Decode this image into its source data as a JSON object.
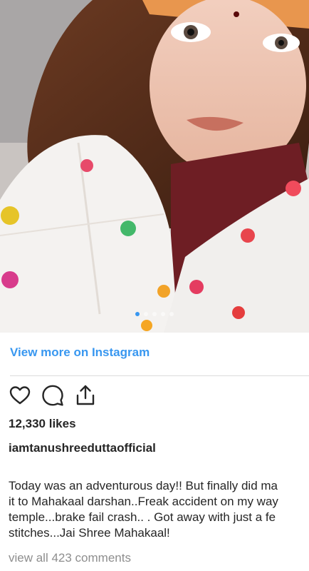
{
  "post": {
    "image_alt": "selfie photo",
    "carousel_dots": 5,
    "carousel_active_index": 0
  },
  "link": {
    "view_more": "View more on Instagram"
  },
  "actions": {
    "like_icon": "heart-icon",
    "comment_icon": "comment-icon",
    "share_icon": "share-icon"
  },
  "stats": {
    "likes": "12,330 likes"
  },
  "author": {
    "username": "iamtanushreeduttaofficial"
  },
  "caption": {
    "lines": [
      "Today was an adventurous day!! But finally did ma",
      "it to Mahakaal darshan..Freak accident on my way",
      "temple...brake fail crash.. . Got away with just a fe",
      "stitches...Jai Shree Mahakaal!"
    ]
  },
  "comments": {
    "view_all": "view all 423 comments"
  },
  "colors": {
    "link_blue": "#3897f0",
    "text_dark": "#262626",
    "text_muted": "#8e8e8e"
  }
}
